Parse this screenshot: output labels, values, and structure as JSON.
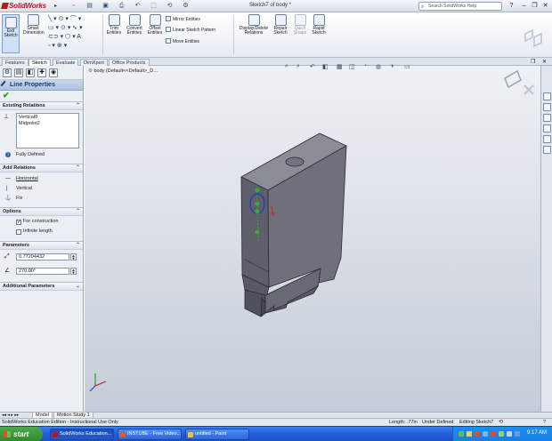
{
  "titlebar": {
    "app_name": "SolidWorks",
    "doc_title": "Sketch7 of body *",
    "search_placeholder": "Search SolidWorks Help"
  },
  "commands": {
    "exit_sketch": "Exit Sketch",
    "smart_dimension": "Smart Dimension",
    "trim_entities": "Trim Entities",
    "convert_entities": "Convert Entities",
    "offset_entities": "Offset Entities",
    "mirror_entities": "Mirror Entities",
    "linear_sketch_pattern": "Linear Sketch Pattern",
    "move_entities": "Move Entities",
    "display_delete_relations": "Display/Delete Relations",
    "repair_sketch": "Repair Sketch",
    "quick_snaps": "Quick Snaps",
    "rapid_sketch": "Rapid Sketch"
  },
  "tabs": [
    "Features",
    "Sketch",
    "Evaluate",
    "DimXpert",
    "Office Products"
  ],
  "active_tab": "Sketch",
  "property_manager": {
    "title": "Line Properties",
    "existing_relations": {
      "header": "Existing Relations",
      "items": [
        "Vertical0",
        "Midpoint2"
      ],
      "status": "Fully Defined"
    },
    "add_relations": {
      "header": "Add Relations",
      "items": [
        "Horizontal",
        "Vertical",
        "Fix"
      ]
    },
    "options": {
      "header": "Options",
      "items": [
        {
          "label": "For construction",
          "checked": true
        },
        {
          "label": "Infinite length",
          "checked": false
        }
      ]
    },
    "parameters": {
      "header": "Parameters",
      "length": "0.77204432",
      "angle": "270.00°"
    },
    "additional_parameters": {
      "header": "Additional Parameters"
    }
  },
  "graphics": {
    "tree_node": "body  (Default<<Default>_D..."
  },
  "bottom_tabs": [
    "Model",
    "Motion Study 1"
  ],
  "status_bar": {
    "left": "SolidWorks Education Edition - Instructional Use Only",
    "length": "Length: .77in",
    "defined": "Under Defined",
    "editing": "Editing Sketch7"
  },
  "taskbar": {
    "start": "start",
    "tasks": [
      "SolidWorks Education...",
      "INSTUBE - Free Video...",
      "untitled - Paint"
    ],
    "clock": "9:17 AM"
  },
  "colors": {
    "title_accent": "#c0141b",
    "taskbar_blue": "#245edb",
    "start_green": "#2e8a2c",
    "model_gray": "#6e6f7c",
    "sketch_blue": "#1f3fbf",
    "relation_green": "#2fae2f"
  }
}
